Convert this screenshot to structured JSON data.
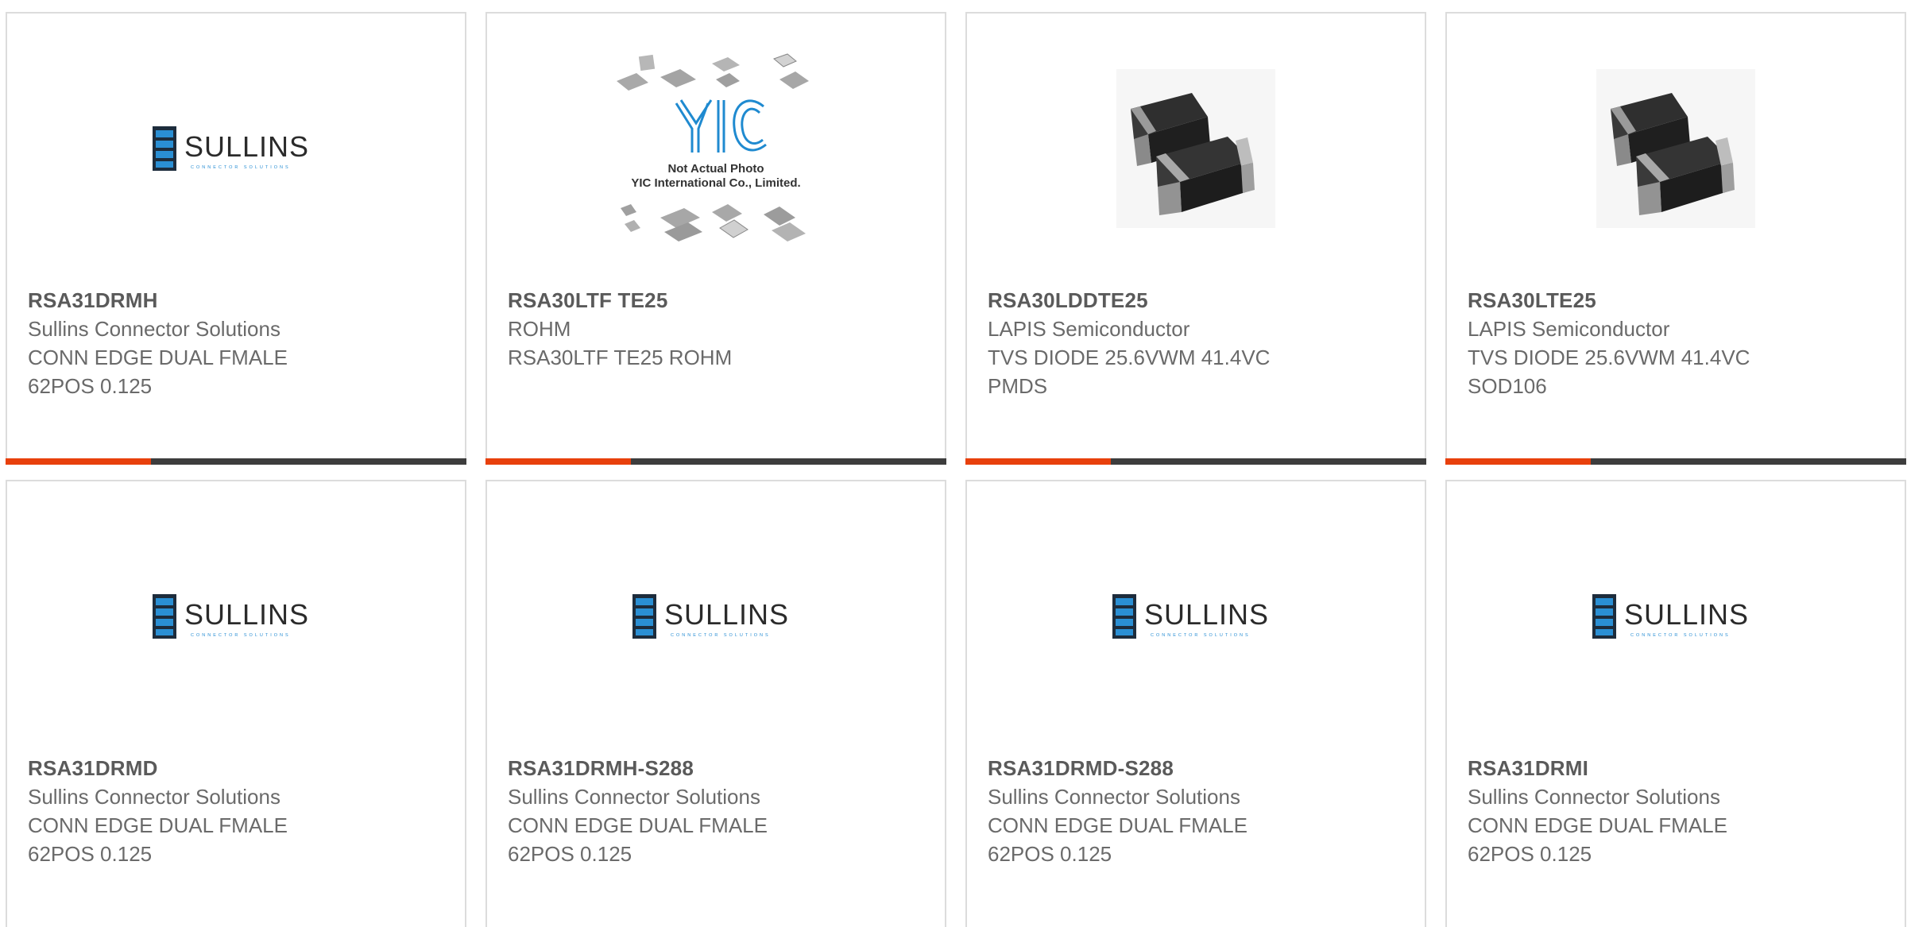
{
  "colors": {
    "accent": "#e8400c",
    "bar_dark": "#3d3d3d",
    "card_border": "#dcdcdc",
    "sullins_blue": "#1f7fc1",
    "yic_blue": "#1f8ad0"
  },
  "products": [
    {
      "part_number": "RSA31DRMH",
      "manufacturer": "Sullins Connector Solutions",
      "desc_line1": "CONN EDGE DUAL FMALE",
      "desc_line2": "62POS 0.125",
      "image": "sullins-logo"
    },
    {
      "part_number": "RSA30LTF TE25",
      "manufacturer": "ROHM",
      "desc_line1": "RSA30LTF TE25 ROHM",
      "desc_line2": "",
      "image": "yic-placeholder"
    },
    {
      "part_number": "RSA30LDDTE25",
      "manufacturer": "LAPIS Semiconductor",
      "desc_line1": "TVS DIODE 25.6VWM 41.4VC",
      "desc_line2": "PMDS",
      "image": "smd-diode-photo"
    },
    {
      "part_number": "RSA30LTE25",
      "manufacturer": "LAPIS Semiconductor",
      "desc_line1": "TVS DIODE 25.6VWM 41.4VC",
      "desc_line2": "SOD106",
      "image": "smd-diode-photo"
    },
    {
      "part_number": "RSA31DRMD",
      "manufacturer": "Sullins Connector Solutions",
      "desc_line1": "CONN EDGE DUAL FMALE",
      "desc_line2": "62POS 0.125",
      "image": "sullins-logo"
    },
    {
      "part_number": "RSA31DRMH-S288",
      "manufacturer": "Sullins Connector Solutions",
      "desc_line1": "CONN EDGE DUAL FMALE",
      "desc_line2": "62POS 0.125",
      "image": "sullins-logo"
    },
    {
      "part_number": "RSA31DRMD-S288",
      "manufacturer": "Sullins Connector Solutions",
      "desc_line1": "CONN EDGE DUAL FMALE",
      "desc_line2": "62POS 0.125",
      "image": "sullins-logo"
    },
    {
      "part_number": "RSA31DRMI",
      "manufacturer": "Sullins Connector Solutions",
      "desc_line1": "CONN EDGE DUAL FMALE",
      "desc_line2": "62POS 0.125",
      "image": "sullins-logo"
    }
  ],
  "logos": {
    "sullins_word": "SULLINS",
    "sullins_tagline": "CONNECTOR SOLUTIONS",
    "yic_mark": "YIC",
    "yic_caption1": "Not Actual Photo",
    "yic_caption2": "YIC International Co., Limited."
  }
}
